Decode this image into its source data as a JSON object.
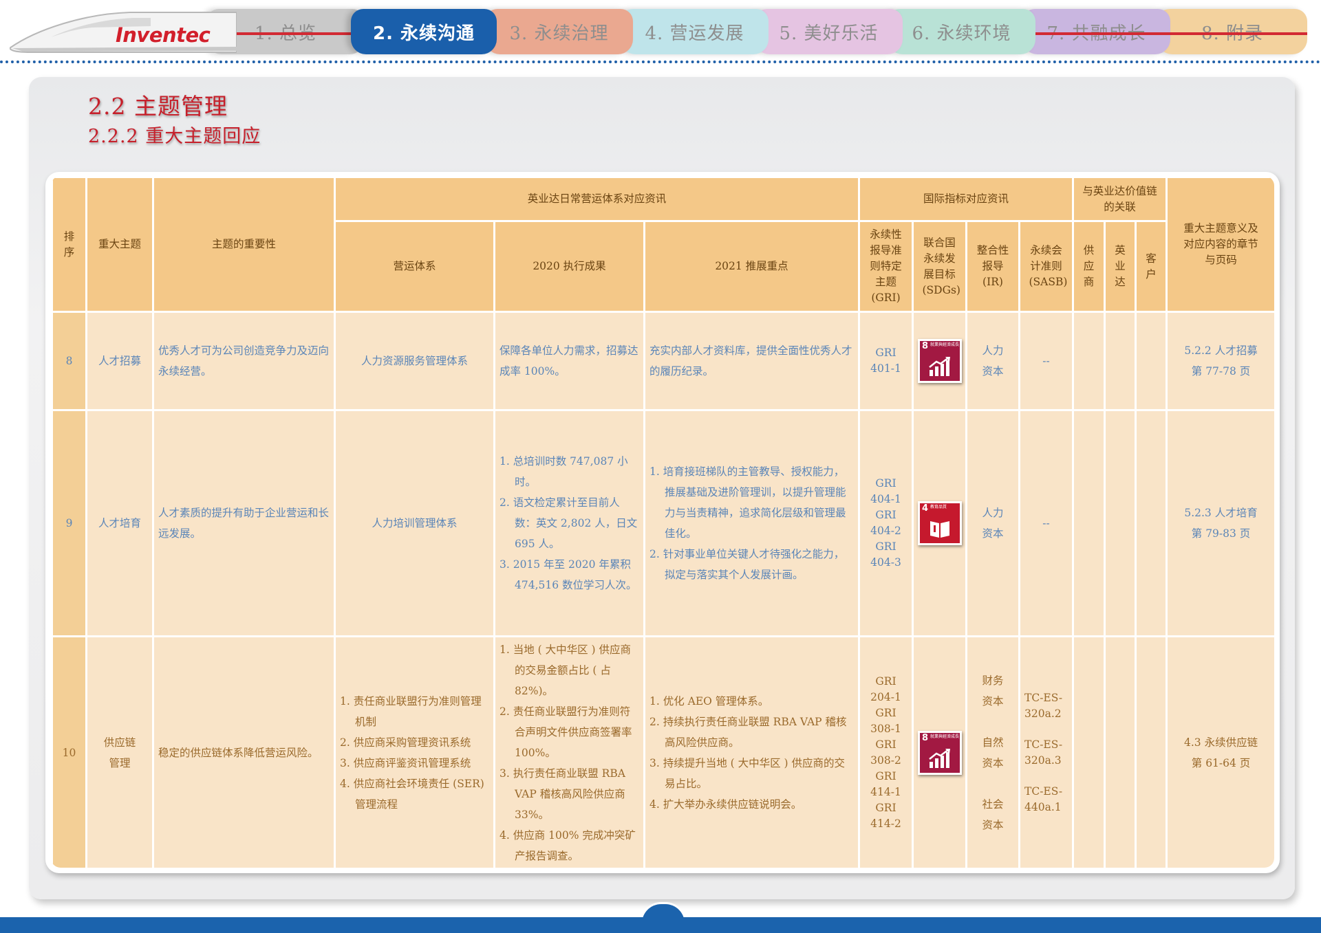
{
  "brand": {
    "logo_text": "Inventec"
  },
  "nav": {
    "tabs": [
      {
        "label": "1. 总览",
        "color": "#c9c9c9",
        "active": false
      },
      {
        "label": "2. 永续沟通",
        "color": "#1a5fab",
        "active": true
      },
      {
        "label": "3. 永续治理",
        "color": "#eaa890",
        "active": false
      },
      {
        "label": "4. 营运发展",
        "color": "#bfe4ea",
        "active": false
      },
      {
        "label": "5. 美好乐活",
        "color": "#e5c4e2",
        "active": false
      },
      {
        "label": "6. 永续环境",
        "color": "#b9e2d6",
        "active": false
      },
      {
        "label": "7. 共融成长",
        "color": "#c9b6e0",
        "active": false
      },
      {
        "label": "8. 附录",
        "color": "#f3d29e",
        "active": false
      }
    ]
  },
  "heading": {
    "section": "2.2  主题管理",
    "subsection": "2.2.2  重大主题回应"
  },
  "table": {
    "headers": {
      "rank": "排序",
      "topic": "重大主题",
      "importance": "主题的重要性",
      "group_ops": "英业达日常营运体系对应资讯",
      "group_intl": "国际指标对应资讯",
      "group_value": "与英业达价值链的关联",
      "chapter": "重大主题意义及对应内容的章节与页码",
      "system": "营运体系",
      "results_2020": "2020 执行成果",
      "focus_2021": "2021 推展重点",
      "gri": "永续性报导准则特定主题(GRI)",
      "sdgs": "联合国永续发展目标(SDGs)",
      "ir": "整合性报导(IR)",
      "sasb": "永续会计准则(SASB)",
      "supplier": "供应商",
      "inventec": "英业达",
      "customer": "客户"
    },
    "rows": [
      {
        "rank": "8",
        "topic": "人才招募",
        "importance": "优秀人才可为公司创造竞争力及迈向永续经营。",
        "system": "人力资源服务管理体系",
        "results_2020": "保障各单位人力需求，招募达成率 100%。",
        "focus_2021": "充实内部人才资料库，提供全面性优秀人才的履历纪录。",
        "gri": [
          "GRI",
          "401-1"
        ],
        "sdg": {
          "number": "8",
          "title": "就業與經濟成長",
          "icon": "growth-chart-icon",
          "color": "#a21942"
        },
        "ir": [
          "人力",
          "资本"
        ],
        "sasb": [
          "--"
        ],
        "chapter": [
          "5.2.2  人才招募",
          "第 77-78 页"
        ]
      },
      {
        "rank": "9",
        "topic": "人才培育",
        "importance": "人才素质的提升有助于企业营运和长远发展。",
        "system": "人力培训管理体系",
        "results_2020": [
          "1.  总培训时数 747,087 小时。",
          "2. 语文检定累计至目前人数：英文 2,802 人，日文 695 人。",
          "3.  2015 年至 2020 年累积 474,516 数位学习人次。"
        ],
        "focus_2021": [
          "1. 培育接班梯队的主管教导、授权能力，推展基础及进阶管理训，以提升管理能力与当责精神，追求简化层级和管理最佳化。",
          "2. 针对事业单位关键人才待强化之能力，拟定与落实其个人发展计画。"
        ],
        "gri": [
          "GRI",
          "404-1",
          "GRI",
          "404-2",
          "GRI",
          "404-3"
        ],
        "sdg": {
          "number": "4",
          "title": "教育品質",
          "icon": "book-icon",
          "color": "#c5192d"
        },
        "ir": [
          "人力",
          "资本"
        ],
        "sasb": [
          "--"
        ],
        "chapter": [
          "5.2.3  人才培育",
          "第 79-83 页"
        ]
      },
      {
        "rank": "10",
        "topic": [
          "供应链",
          "管理"
        ],
        "importance": "稳定的供应链体系降低营运风险。",
        "system": [
          "1. 责任商业联盟行为准则管理机制",
          "2. 供应商采购管理资讯系统",
          "3. 供应商评鉴资讯管理系统",
          "4. 供应商社会环境责任 (SER) 管理流程"
        ],
        "results_2020": [
          "1. 当地 ( 大中华区 ) 供应商的交易金额占比 ( 占 82%)。",
          "2. 责任商业联盟行为准则符合声明文件供应商签署率 100%。",
          "3. 执行责任商业联盟 RBA VAP 稽核高风险供应商 33%。",
          "4. 供应商 100% 完成冲突矿产报告调查。"
        ],
        "focus_2021": [
          "1. 优化 AEO 管理体系。",
          "2. 持续执行责任商业联盟 RBA  VAP 稽核高风险供应商。",
          "3. 持续提升当地 ( 大中华区 ) 供应商的交易占比。",
          "4. 扩大举办永续供应链说明会。"
        ],
        "gri": [
          "GRI",
          "204-1",
          "GRI",
          "308-1",
          "GRI",
          "308-2",
          "GRI",
          "414-1",
          "GRI",
          "414-2"
        ],
        "sdg": {
          "number": "8",
          "title": "就業與經濟成長",
          "icon": "growth-chart-icon",
          "color": "#a21942"
        },
        "ir": [
          "财务",
          "资本",
          "自然",
          "资本",
          "社会",
          "资本"
        ],
        "sasb": [
          "TC-ES-",
          "320a.2",
          "TC-ES-",
          "320a.3",
          "TC-ES-",
          "440a.1"
        ],
        "chapter": [
          "4.3  永续供应链",
          "第 61-64 页"
        ]
      }
    ]
  }
}
